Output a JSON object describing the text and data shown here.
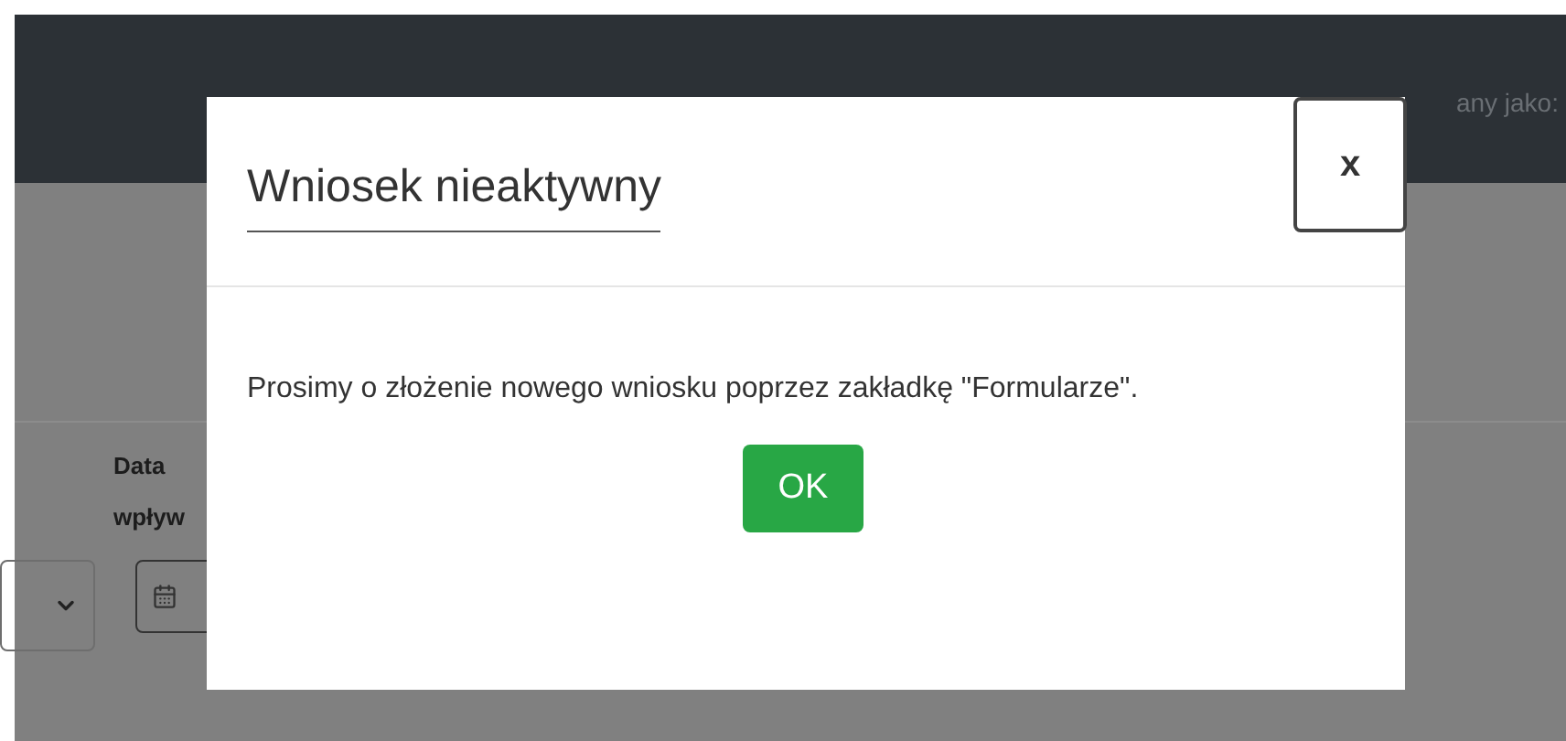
{
  "header": {
    "user_text": "any jako:"
  },
  "form": {
    "date_label": "Data",
    "date_label_2": "wpływ"
  },
  "modal": {
    "title": "Wniosek nieaktywny",
    "close_label": "x",
    "message": "Prosimy o złożenie nowego wniosku poprzez zakładkę \"Formularze\".",
    "ok_label": "OK"
  }
}
